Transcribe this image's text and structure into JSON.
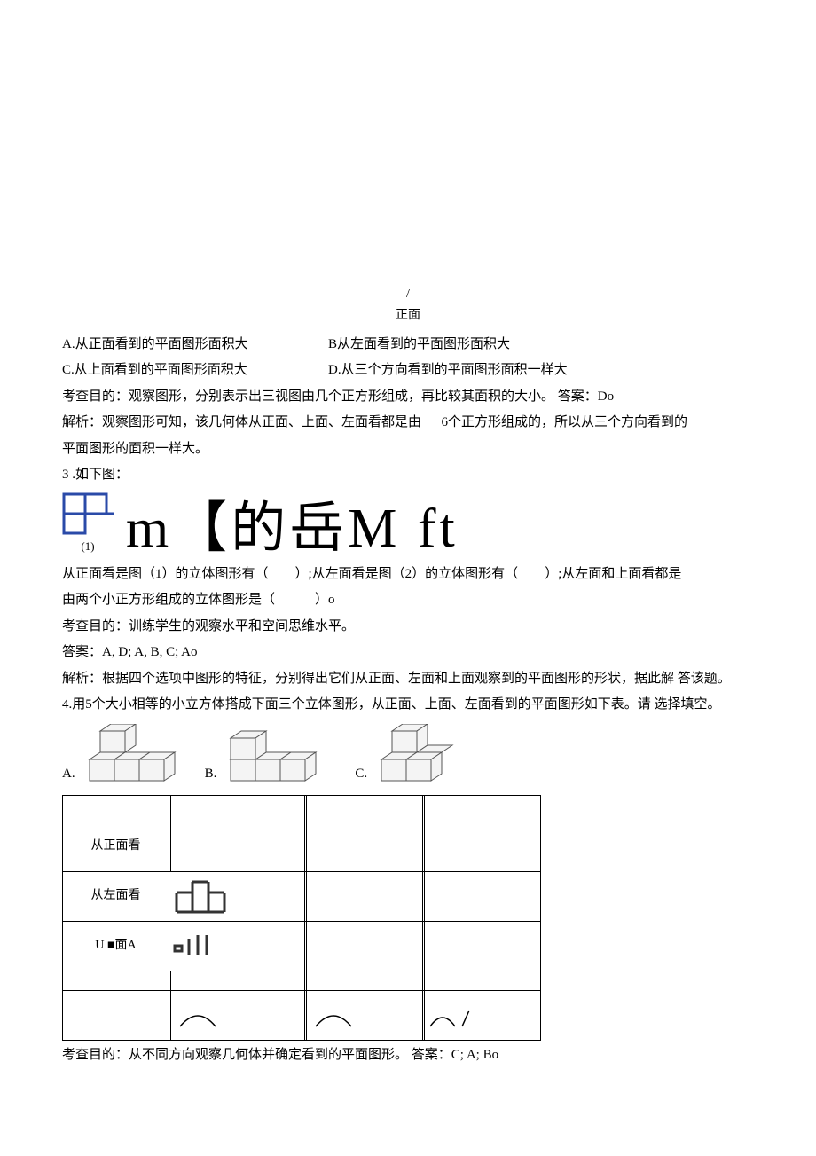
{
  "header": {
    "slash": "/",
    "front_label": "正面"
  },
  "q2_options": {
    "a": "A.从正面看到的平面图形面积大",
    "b": "B从左面看到的平面图形面积大",
    "c": "C.从上面看到的平面图形面积大",
    "d": "D.从三个方向看到的平面图形面积一样大"
  },
  "q2_purpose": "考查目的：观察图形，分别表示出三视图由几个正方形组成，再比较其面积的大小。 答案：Do",
  "q2_analysis_pre": "解析：观察图形可知，该几何体从正面、上面、左面看都是由",
  "q2_analysis_mid": "6个正方形组成的，所以从三个方向看到的",
  "q2_analysis_line2": "平面图形的面积一样大。",
  "q3_title": "3 .如下图：",
  "q3_glyphs": {
    "sub1": "(1)",
    "big": "m【的岳M ft"
  },
  "q3_fill1_pre": "从正面看是图（1）的立体图形有（",
  "q3_fill1_mid": "）;从左面看是图（2）的立体图形有（",
  "q3_fill1_post": "）;从左面和上面看都是",
  "q3_fill2": "由两个小正方形组成的立体图形是（　　　）o",
  "q3_purpose": "考查目的：训练学生的观察水平和空间思维水平。",
  "q3_answer": "答案：A, D; A, B, C; Ao",
  "q3_analysis": "解析：根据四个选项中图形的特征，分别得出它们从正面、左面和上面观察到的平面图形的形状，据此解 答该题。",
  "q4_stem": "4.用5个大小相等的小立方体搭成下面三个立体图形，从正面、上面、左面看到的平面图形如下表。请 选择填空。",
  "q4_opts": {
    "a": "A.",
    "b": "B.",
    "c": "C."
  },
  "table": {
    "row1": "从正面看",
    "row2": "从左面看",
    "row3": "U ■面A"
  },
  "q4_purpose": "考查目的：从不同方向观察几何体并确定看到的平面图形。 答案：C; A; Bo"
}
